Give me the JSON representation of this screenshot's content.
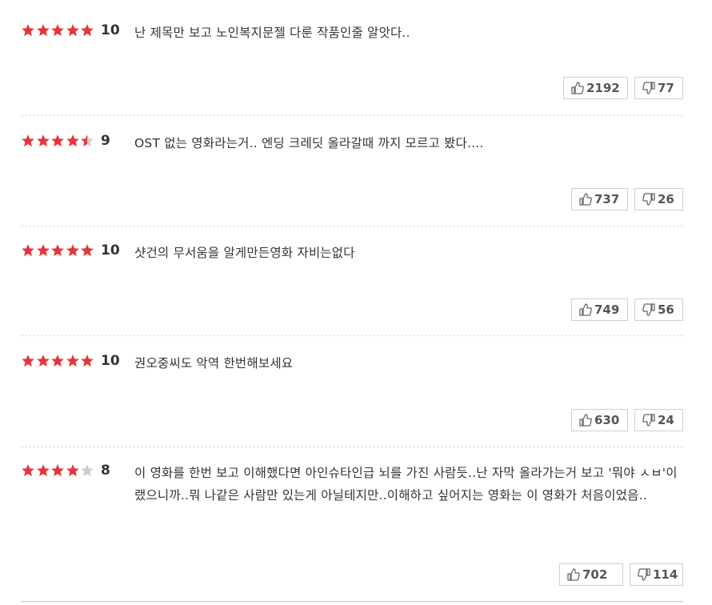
{
  "colors": {
    "star_full": "#e6343a",
    "star_empty": "#cccccc"
  },
  "reviews": [
    {
      "stars": 5,
      "score": "10",
      "text": "난 제목만 보고 노인복지문젤 다룬 작품인줄 알앗다..",
      "likes": "2192",
      "dislikes": "77"
    },
    {
      "stars": 4.5,
      "score": "9",
      "text": "OST 없는 영화라는거.. 엔딩 크레딧 올라갈때 까지 모르고 봤다....",
      "likes": "737",
      "dislikes": "26"
    },
    {
      "stars": 5,
      "score": "10",
      "text": "샷건의 무서움을 알게만든영화 자비는없다",
      "likes": "749",
      "dislikes": "56"
    },
    {
      "stars": 5,
      "score": "10",
      "text": "권오중씨도 악역 한번해보세요",
      "likes": "630",
      "dislikes": "24"
    },
    {
      "stars": 4,
      "score": "8",
      "text": "이 영화를 한번 보고 이해했다면 아인슈타인급 뇌를 가진 사람듯..난 자막 올라가는거 보고 '뭐야 ㅅㅂ'이랬으니까..뭐 나같은 사람만 있는게 아닐테지만..이해하고 싶어지는 영화는 이 영화가 처음이었음..",
      "likes": "702",
      "dislikes": "114"
    }
  ]
}
